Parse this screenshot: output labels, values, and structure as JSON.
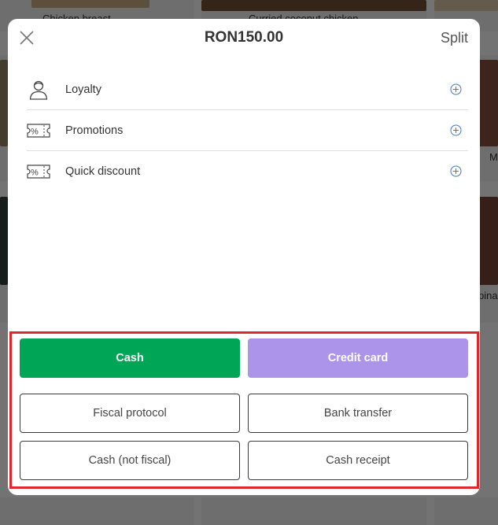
{
  "background": {
    "tiles": [
      {
        "label": "Chicken breast"
      },
      {
        "label": "Curried coconut chicken"
      },
      {
        "label": "M"
      },
      {
        "label": "pinac"
      }
    ]
  },
  "modal": {
    "close_icon": "close-icon",
    "total": "RON150.00",
    "split_label": "Split",
    "options": [
      {
        "label": "Loyalty",
        "icon": "user-icon"
      },
      {
        "label": "Promotions",
        "icon": "percent-ticket-icon"
      },
      {
        "label": "Quick discount",
        "icon": "percent-ticket-icon"
      }
    ],
    "add_icon": "plus-circle-icon",
    "payments": {
      "cash": "Cash",
      "credit_card": "Credit card",
      "fiscal_protocol": "Fiscal protocol",
      "bank_transfer": "Bank transfer",
      "cash_not_fiscal": "Cash (not fiscal)",
      "cash_receipt": "Cash receipt"
    }
  },
  "colors": {
    "cash_button": "#00a655",
    "credit_card_button": "#ab94ea",
    "highlight_border": "#e3262b",
    "add_icon": "#3a7bd5"
  }
}
